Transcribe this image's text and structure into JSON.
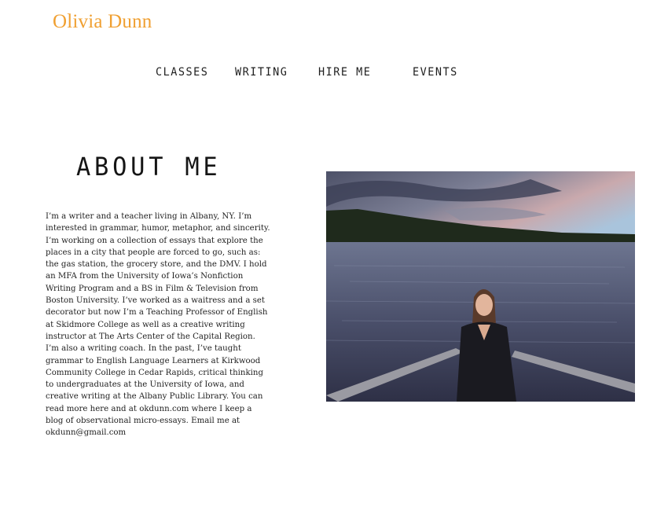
{
  "site": {
    "title": "Olivia Dunn",
    "title_color": "#f0a032"
  },
  "nav": {
    "items": [
      {
        "label": "CLASSES"
      },
      {
        "label": "WRITING"
      },
      {
        "label": "HIRE ME"
      },
      {
        "label": "EVENTS"
      }
    ]
  },
  "about": {
    "heading": "ABOUT ME",
    "bio": "I’m a writer and a teacher living in Albany, NY. I’m interested in grammar, humor, metaphor, and sincerity. I’m working on a collection of essays that explore the places in a city that people are forced to go, such as: the gas station, the grocery store, and the DMV. I hold an MFA from the University of Iowa’s Nonfiction Writing Program and a BS in Film & Television from Boston University. I’ve worked as a waitress and a set decorator but now I’m a Teaching Professor of English at Skidmore College as well as a creative writing instructor at The Arts Center of the Capital Region. I’m also a writing coach. In the past, I’ve taught grammar to English Language Learners at Kirkwood Community College in Cedar Rapids, critical thinking to undergraduates at the University of Iowa, and creative writing at the Albany Public Library. You can read more here and at okdunn.com where I keep a blog of observational micro-essays. Email me at okdunn@gmail.com"
  },
  "colors": {
    "sky_top": "#5b6076",
    "sky_sunset": "#e8b0a0",
    "water": "#4a4f6a",
    "treeline": "#1f2a1c"
  }
}
